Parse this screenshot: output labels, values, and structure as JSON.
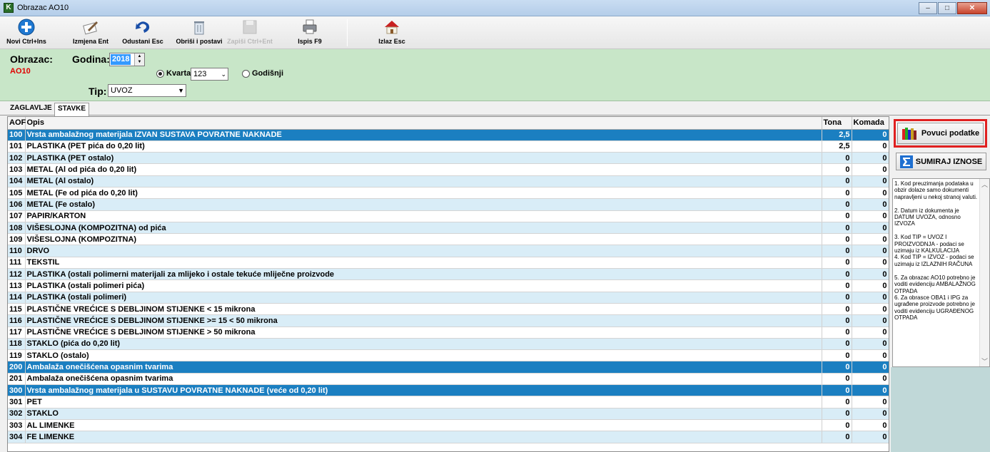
{
  "window": {
    "title": "Obrazac AO10"
  },
  "toolbar": {
    "buttons": [
      {
        "label": "Novi Ctrl+Ins",
        "icon": "plus-icon"
      },
      {
        "label": "Izmjena Ent",
        "icon": "edit-icon"
      },
      {
        "label": "Odustani Esc",
        "icon": "undo-icon"
      },
      {
        "label": "Obriši i postavi",
        "icon": "trash-icon"
      },
      {
        "label": "Zapiši Ctrl+Ent",
        "icon": "save-icon"
      },
      {
        "label": "Ispis F9",
        "icon": "print-icon"
      },
      {
        "label": "Izlaz Esc",
        "icon": "home-icon"
      }
    ]
  },
  "header": {
    "obrazac_label": "Obrazac:",
    "obrazac_value": "AO10",
    "godina_label": "Godina:",
    "godina_value": "2018",
    "kvartal_label": "Kvartal",
    "kvartal_value": "123",
    "godisnji_label": "Godišnji",
    "tip_label": "Tip:",
    "tip_value": "UVOZ"
  },
  "tabs": [
    "ZAGLAVLJE",
    "STAVKE"
  ],
  "grid": {
    "columns": [
      "AOF",
      "Opis",
      "Tona",
      "Komada"
    ],
    "rows": [
      {
        "aof": "100",
        "opis": "Vrsta ambalažnog materijala IZVAN SUSTAVA POVRATNE NAKNADE",
        "tona": "2,5",
        "komada": "0"
      },
      {
        "aof": "101",
        "opis": "PLASTIKA (PET pića do 0,20 lit)",
        "tona": "2,5",
        "komada": "0"
      },
      {
        "aof": "102",
        "opis": "PLASTIKA (PET ostalo)",
        "tona": "0",
        "komada": "0"
      },
      {
        "aof": "103",
        "opis": "METAL (Al od pića do 0,20 lit)",
        "tona": "0",
        "komada": "0"
      },
      {
        "aof": "104",
        "opis": "METAL (Al ostalo)",
        "tona": "0",
        "komada": "0"
      },
      {
        "aof": "105",
        "opis": "METAL (Fe od pića do 0,20 lit)",
        "tona": "0",
        "komada": "0"
      },
      {
        "aof": "106",
        "opis": "METAL (Fe ostalo)",
        "tona": "0",
        "komada": "0"
      },
      {
        "aof": "107",
        "opis": "PAPIR/KARTON",
        "tona": "0",
        "komada": "0"
      },
      {
        "aof": "108",
        "opis": "VIŠESLOJNA (KOMPOZITNA) od pića",
        "tona": "0",
        "komada": "0"
      },
      {
        "aof": "109",
        "opis": "VIŠESLOJNA (KOMPOZITNA)",
        "tona": "0",
        "komada": "0"
      },
      {
        "aof": "110",
        "opis": "DRVO",
        "tona": "0",
        "komada": "0"
      },
      {
        "aof": "111",
        "opis": "TEKSTIL",
        "tona": "0",
        "komada": "0"
      },
      {
        "aof": "112",
        "opis": "PLASTIKA (ostali polimerni materijali za mlijeko i ostale tekuće mliječne proizvode",
        "tona": "0",
        "komada": "0"
      },
      {
        "aof": "113",
        "opis": "PLASTIKA (ostali polimeri pića)",
        "tona": "0",
        "komada": "0"
      },
      {
        "aof": "114",
        "opis": "PLASTIKA (ostali polimeri)",
        "tona": "0",
        "komada": "0"
      },
      {
        "aof": "115",
        "opis": "PLASTIČNE VREĆICE S DEBLJINOM STIJENKE < 15 mikrona",
        "tona": "0",
        "komada": "0"
      },
      {
        "aof": "116",
        "opis": "PLASTIČNE VREĆICE S DEBLJINOM STIJENKE >= 15 < 50 mikrona",
        "tona": "0",
        "komada": "0"
      },
      {
        "aof": "117",
        "opis": "PLASTIČNE VREĆICE S DEBLJINOM STIJENKE > 50 mikrona",
        "tona": "0",
        "komada": "0"
      },
      {
        "aof": "118",
        "opis": "STAKLO (pića do 0,20 lit)",
        "tona": "0",
        "komada": "0"
      },
      {
        "aof": "119",
        "opis": "STAKLO (ostalo)",
        "tona": "0",
        "komada": "0"
      },
      {
        "aof": "200",
        "opis": "Ambalaža onečišćena opasnim tvarima",
        "tona": "0",
        "komada": "0"
      },
      {
        "aof": "201",
        "opis": "Ambalaža onečišćena opasnim tvarima",
        "tona": "0",
        "komada": "0"
      },
      {
        "aof": "300",
        "opis": "Vrsta ambalažnog materijala u SUSTAVU POVRATNE NAKNADE (veće od 0,20 lit)",
        "tona": "0",
        "komada": "0"
      },
      {
        "aof": "301",
        "opis": "PET",
        "tona": "0",
        "komada": "0"
      },
      {
        "aof": "302",
        "opis": "STAKLO",
        "tona": "0",
        "komada": "0"
      },
      {
        "aof": "303",
        "opis": "AL LIMENKE",
        "tona": "0",
        "komada": "0"
      },
      {
        "aof": "304",
        "opis": "FE LIMENKE",
        "tona": "0",
        "komada": "0"
      }
    ]
  },
  "side": {
    "povuci_label": "Povuci podatke",
    "sumiraj_label": "SUMIRAJ IZNOSE",
    "notes": "1. Kod preuzimanja podataka u obzir dolaze samo dokumenti napravljeni u nekoj stranoj valuti.\n\n2. Datum iz dokumenta je DATUM UVOZA, odnosno IZVOZA\n\n3. Kod TIP = UVOZ I PROIZVODNJA - podaci se uzimaju iz KALKULACIJA\n4. Kod TIP = IZVOZ - podaci se uzimaju iz IZLAZNIH RAČUNA\n\n5. Za obrazac AO10 potrebno je voditi evidenciju AMBALAŽNOG OTPADA\n6. Za obrasce OBA1 i IPG za ugrađene proizvode potrebno je voditi evidenciju UGRAĐENOG OTPADA"
  },
  "colors": {
    "header_bg": "#c8e6c8",
    "highlight_row": "#1b7fc1",
    "even_row": "#d9edf7",
    "red_frame": "#e02020"
  }
}
